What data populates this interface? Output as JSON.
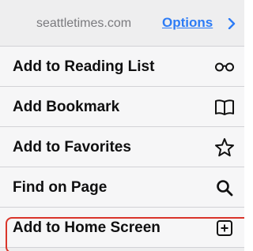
{
  "header": {
    "domain": "seattletimes.com",
    "options_label": "Options",
    "chevron_icon": "chevron-right-icon",
    "options_color": "#2d7cf6"
  },
  "menu": {
    "items": [
      {
        "label": "Add to Reading List",
        "icon": "glasses-icon"
      },
      {
        "label": "Add Bookmark",
        "icon": "book-icon"
      },
      {
        "label": "Add to Favorites",
        "icon": "star-icon"
      },
      {
        "label": "Find on Page",
        "icon": "magnifier-icon"
      },
      {
        "label": "Add to Home Screen",
        "icon": "plus-square-icon",
        "highlighted": true
      }
    ]
  },
  "highlight_color": "#d9352a"
}
